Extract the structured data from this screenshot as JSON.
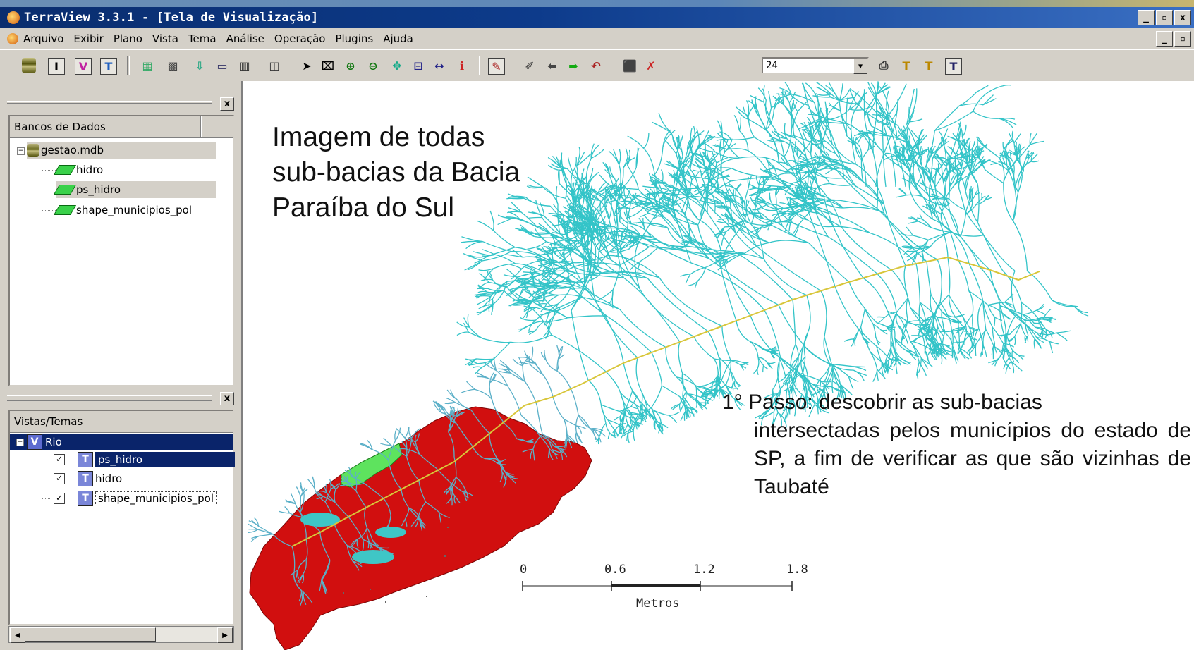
{
  "window": {
    "title": "TerraView 3.3.1 - [Tela de Visualização]",
    "controls": [
      "_",
      "▫",
      "x"
    ]
  },
  "menu": {
    "items": [
      {
        "label": "Arquivo"
      },
      {
        "label": "Exibir"
      },
      {
        "label": "Plano"
      },
      {
        "label": "Vista"
      },
      {
        "label": "Tema"
      },
      {
        "label": "Análise"
      },
      {
        "label": "Operação"
      },
      {
        "label": "Plugins"
      },
      {
        "label": "Ajuda"
      }
    ]
  },
  "toolbar": {
    "zoom_value": "24",
    "icons": [
      "database-icon",
      "info-layer-icon",
      "view-icon",
      "theme-icon",
      "add-layer-icon",
      "print-layer-icon",
      "import-icon",
      "display-icon",
      "grid-icon",
      "table-icon",
      "pointer-icon",
      "zoom-area-icon",
      "zoom-in-icon",
      "zoom-out-icon",
      "pan-icon",
      "fit-icon",
      "measure-icon",
      "info-icon",
      "edit-icon",
      "draw-icon",
      "back-icon",
      "forward-icon",
      "undo-icon",
      "select-icon",
      "delete-icon",
      "printer-icon",
      "text-icon",
      "font-icon",
      "text-visual-icon"
    ]
  },
  "databases_panel": {
    "header": "Bancos de Dados",
    "database": "gestao.mdb",
    "layers": [
      "hidro",
      "ps_hidro",
      "shape_municipios_pol"
    ]
  },
  "views_panel": {
    "header": "Vistas/Temas",
    "view": "Rio",
    "themes": [
      {
        "label": "ps_hidro",
        "checked": true
      },
      {
        "label": "hidro",
        "checked": true
      },
      {
        "label": "shape_municipios_pol",
        "checked": true
      }
    ]
  },
  "map": {
    "overlay_title": "Imagem de todas\nsub-bacias da Bacia\nParaíba do Sul",
    "step_first_line": "1° Passo: descobrir as sub-bacias",
    "step_rest": "intersectadas pelos  municípios do estado de SP, a fim de verificar as que são vizinhas de Taubaté",
    "scale": {
      "ticks": [
        "0",
        "0.6",
        "1.2",
        "1.8"
      ],
      "unit": "Metros"
    },
    "colors": {
      "rivers": "#33c4c8",
      "municipalities": "#d10f0f",
      "taubate": "#5ee35e",
      "main_river": "#d8c63a"
    }
  }
}
